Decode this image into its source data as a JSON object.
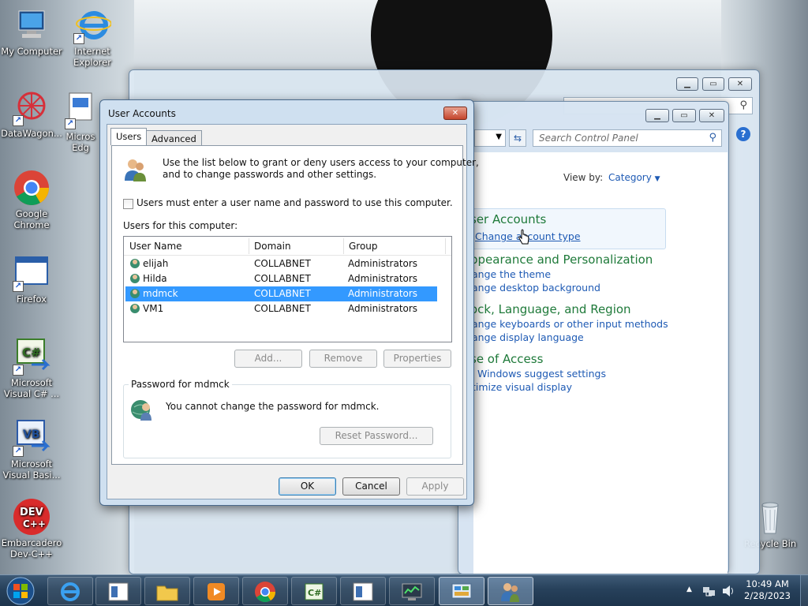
{
  "desktop": {
    "icons": [
      {
        "label": "My Computer"
      },
      {
        "label": "Internet Explorer"
      },
      {
        "label": "DataWagon..."
      },
      {
        "label": "Micros Edg"
      },
      {
        "label": "Google Chrome"
      },
      {
        "label": "Firefox"
      },
      {
        "label": "Microsoft Visual C# ..."
      },
      {
        "label": "Microsoft Visual Basi..."
      },
      {
        "label": "Embarcadero Dev-C++"
      },
      {
        "label": "Recycle Bin"
      }
    ]
  },
  "control_panel": {
    "search_placeholder": "Search Control Panel",
    "view_by_label": "View by:",
    "view_by_value": "Category",
    "sections": [
      {
        "heading": "ser Accounts",
        "links": [
          "Change account type"
        ]
      },
      {
        "heading": "ppearance and Personalization",
        "links": [
          "ange the theme",
          "ange desktop background"
        ]
      },
      {
        "heading": "ock, Language, and Region",
        "links": [
          "ange keyboards or other input methods",
          "ange display language"
        ]
      },
      {
        "heading": "se of Access",
        "links": [
          "Windows suggest settings",
          "timize visual display"
        ]
      }
    ]
  },
  "dialog": {
    "title": "User Accounts",
    "close_symbol": "✕",
    "tabs": [
      "Users",
      "Advanced"
    ],
    "intro_text_line1": "Use the list below to grant or deny users access to your computer,",
    "intro_text_line2": "and to change passwords and other settings.",
    "require_password_label": "Users must enter a user name and password to use this computer.",
    "require_password_checked": false,
    "users_label": "Users for this computer:",
    "columns": [
      "User Name",
      "Domain",
      "Group"
    ],
    "users": [
      {
        "name": "elijah",
        "domain": "COLLABNET",
        "group": "Administrators",
        "selected": false
      },
      {
        "name": "Hilda",
        "domain": "COLLABNET",
        "group": "Administrators",
        "selected": false
      },
      {
        "name": "mdmck",
        "domain": "COLLABNET",
        "group": "Administrators",
        "selected": true
      },
      {
        "name": "VM1",
        "domain": "COLLABNET",
        "group": "Administrators",
        "selected": false
      }
    ],
    "add_button": "Add...",
    "remove_button": "Remove",
    "properties_button": "Properties",
    "password_group_title": "Password for mdmck",
    "password_text": "You cannot change the password for mdmck.",
    "reset_password_button": "Reset Password...",
    "ok_button": "OK",
    "cancel_button": "Cancel",
    "apply_button": "Apply"
  },
  "taskbar": {
    "time": "10:49 AM",
    "date": "2/28/2023"
  }
}
